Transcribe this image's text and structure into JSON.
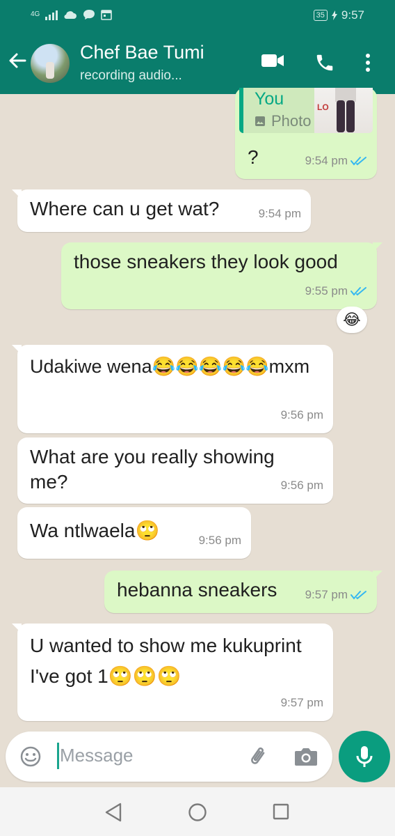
{
  "status_bar": {
    "network": "4G",
    "battery": "35",
    "time": "9:57"
  },
  "header": {
    "contact_name": "Chef Bae Tumi",
    "status": "recording audio..."
  },
  "messages": [
    {
      "direction": "out",
      "quote": {
        "author": "You",
        "type": "Photo"
      },
      "text": "?",
      "time": "9:54 pm",
      "read": true
    },
    {
      "direction": "in",
      "text": "Where can u get wat?",
      "time": "9:54 pm"
    },
    {
      "direction": "out",
      "text": "those sneakers they look good",
      "time": "9:55 pm",
      "read": true,
      "reaction": "😂"
    },
    {
      "direction": "in",
      "text": "Udakiwe wena😂😂😂😂😂mxm",
      "time": "9:56 pm"
    },
    {
      "direction": "in",
      "text": "What are you really showing me?",
      "time": "9:56 pm"
    },
    {
      "direction": "in",
      "text": "Wa ntlwaela🙄",
      "time": "9:56 pm"
    },
    {
      "direction": "out",
      "text": "hebanna sneakers",
      "time": "9:57 pm",
      "read": true
    },
    {
      "direction": "in",
      "text": "U wanted to show me kukuprint I've got 1🙄🙄🙄",
      "time": "9:57 pm"
    }
  ],
  "composer": {
    "placeholder": "Message"
  },
  "colors": {
    "header": "#0a7d6c",
    "outgoing_bubble": "#dcf8c6",
    "incoming_bubble": "#ffffff",
    "read_ticks": "#34b7f1",
    "accent": "#0a9d7f"
  },
  "icons": {
    "back": "arrow-left-icon",
    "video": "video-call-icon",
    "call": "phone-icon",
    "menu": "more-vert-icon",
    "emoji": "emoji-icon",
    "attach": "paperclip-icon",
    "camera": "camera-icon",
    "mic": "mic-icon"
  }
}
